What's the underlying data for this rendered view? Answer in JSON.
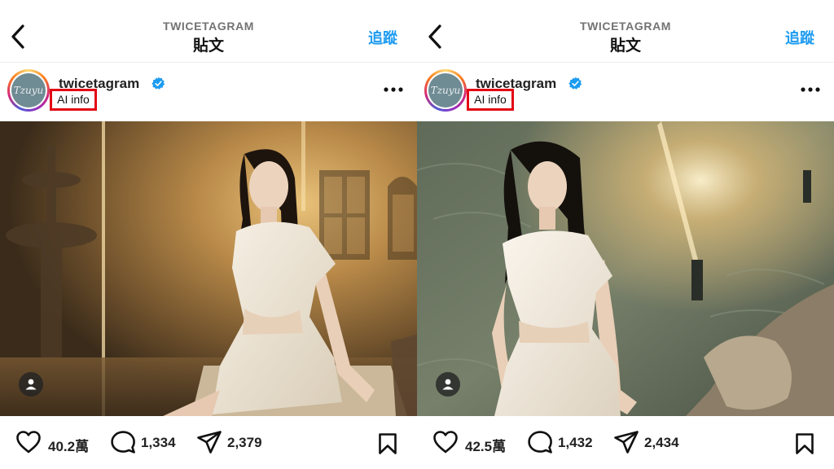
{
  "panels": [
    {
      "header": {
        "account": "TWICETAGRAM",
        "title": "貼文",
        "follow": "追蹤"
      },
      "post": {
        "username": "twicetagram",
        "ai_label": "AI info",
        "avatar_text": "Tzuyu",
        "likes": "40.2萬",
        "comments": "1,334",
        "shares": "2,379"
      }
    },
    {
      "header": {
        "account": "TWICETAGRAM",
        "title": "貼文",
        "follow": "追蹤"
      },
      "post": {
        "username": "twicetagram",
        "ai_label": "AI info",
        "avatar_text": "Tzuyu",
        "likes": "42.5萬",
        "comments": "1,432",
        "shares": "2,434"
      }
    }
  ],
  "icons": {
    "back": "chevron-left-icon",
    "verified": "verified-badge-icon",
    "more": "more-horizontal-icon",
    "tag": "user-tag-icon",
    "like": "heart-icon",
    "comment": "comment-icon",
    "share": "paper-plane-icon",
    "save": "bookmark-icon"
  },
  "colors": {
    "follow_link": "#1d9bf0",
    "verified_badge": "#1d9bf0",
    "ai_highlight_box": "#e30613",
    "muted_text": "#737373"
  }
}
